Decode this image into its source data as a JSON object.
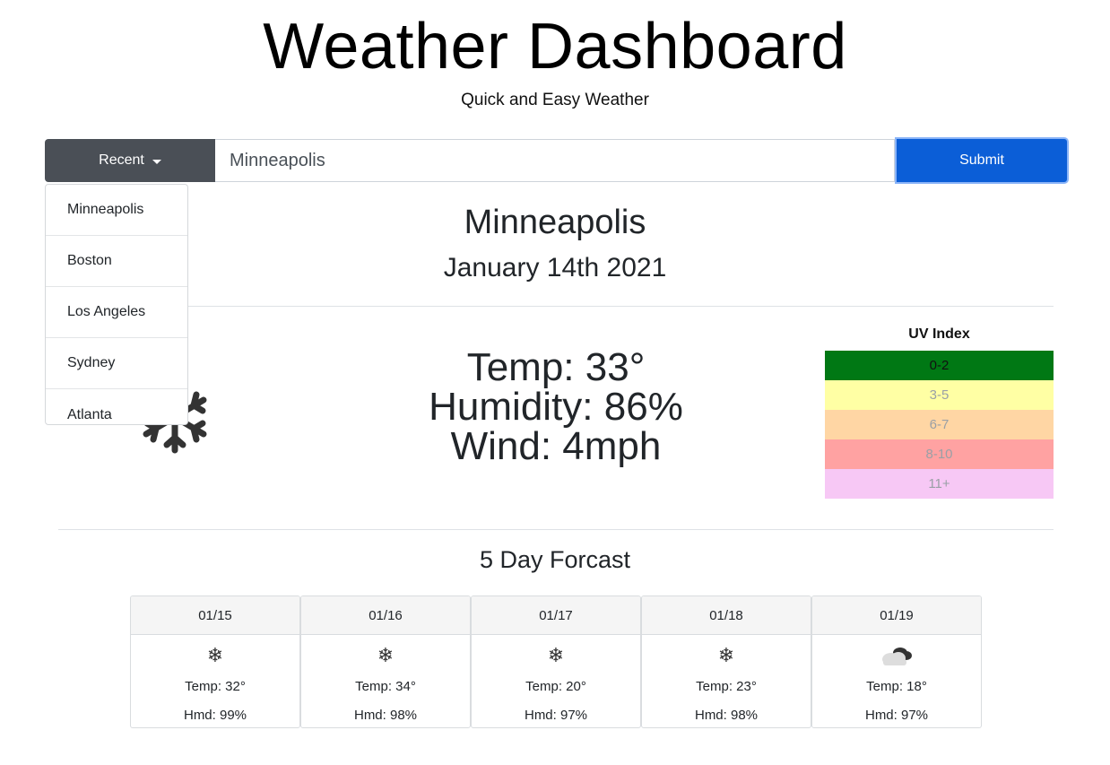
{
  "header": {
    "title": "Weather Dashboard",
    "subtitle": "Quick and Easy Weather"
  },
  "search": {
    "recent_label": "Recent",
    "input_value": "Minneapolis",
    "submit_label": "Submit",
    "recent_items": [
      "Minneapolis",
      "Boston",
      "Los Angeles",
      "Sydney",
      "Atlanta"
    ]
  },
  "current": {
    "city": "Minneapolis",
    "date": "January 14th 2021",
    "temp": "Temp: 33°",
    "humidity": "Humidity: 86%",
    "wind": "Wind: 4mph",
    "icon": "snowflake-icon"
  },
  "uv": {
    "title": "UV Index",
    "levels": [
      {
        "label": "0-2",
        "color": "#007814",
        "active": true
      },
      {
        "label": "3-5",
        "color": "#ffffa4",
        "active": false
      },
      {
        "label": "6-7",
        "color": "#ffd6a4",
        "active": false
      },
      {
        "label": "8-10",
        "color": "#ffa2a2",
        "active": false
      },
      {
        "label": "11+",
        "color": "#f7c8f5",
        "active": false
      }
    ]
  },
  "forecast": {
    "title": "5 Day Forcast",
    "days": [
      {
        "date": "01/15",
        "icon": "snowflake-icon",
        "temp": "Temp: 32°",
        "hmd": "Hmd: 99%"
      },
      {
        "date": "01/16",
        "icon": "snowflake-icon",
        "temp": "Temp: 34°",
        "hmd": "Hmd: 98%"
      },
      {
        "date": "01/17",
        "icon": "snowflake-icon",
        "temp": "Temp: 20°",
        "hmd": "Hmd: 97%"
      },
      {
        "date": "01/18",
        "icon": "snowflake-icon",
        "temp": "Temp: 23°",
        "hmd": "Hmd: 98%"
      },
      {
        "date": "01/19",
        "icon": "cloud-icon",
        "temp": "Temp: 18°",
        "hmd": "Hmd: 97%"
      }
    ]
  },
  "colors": {
    "accent": "#0b5ed7",
    "recent_button": "#4a4f56"
  }
}
